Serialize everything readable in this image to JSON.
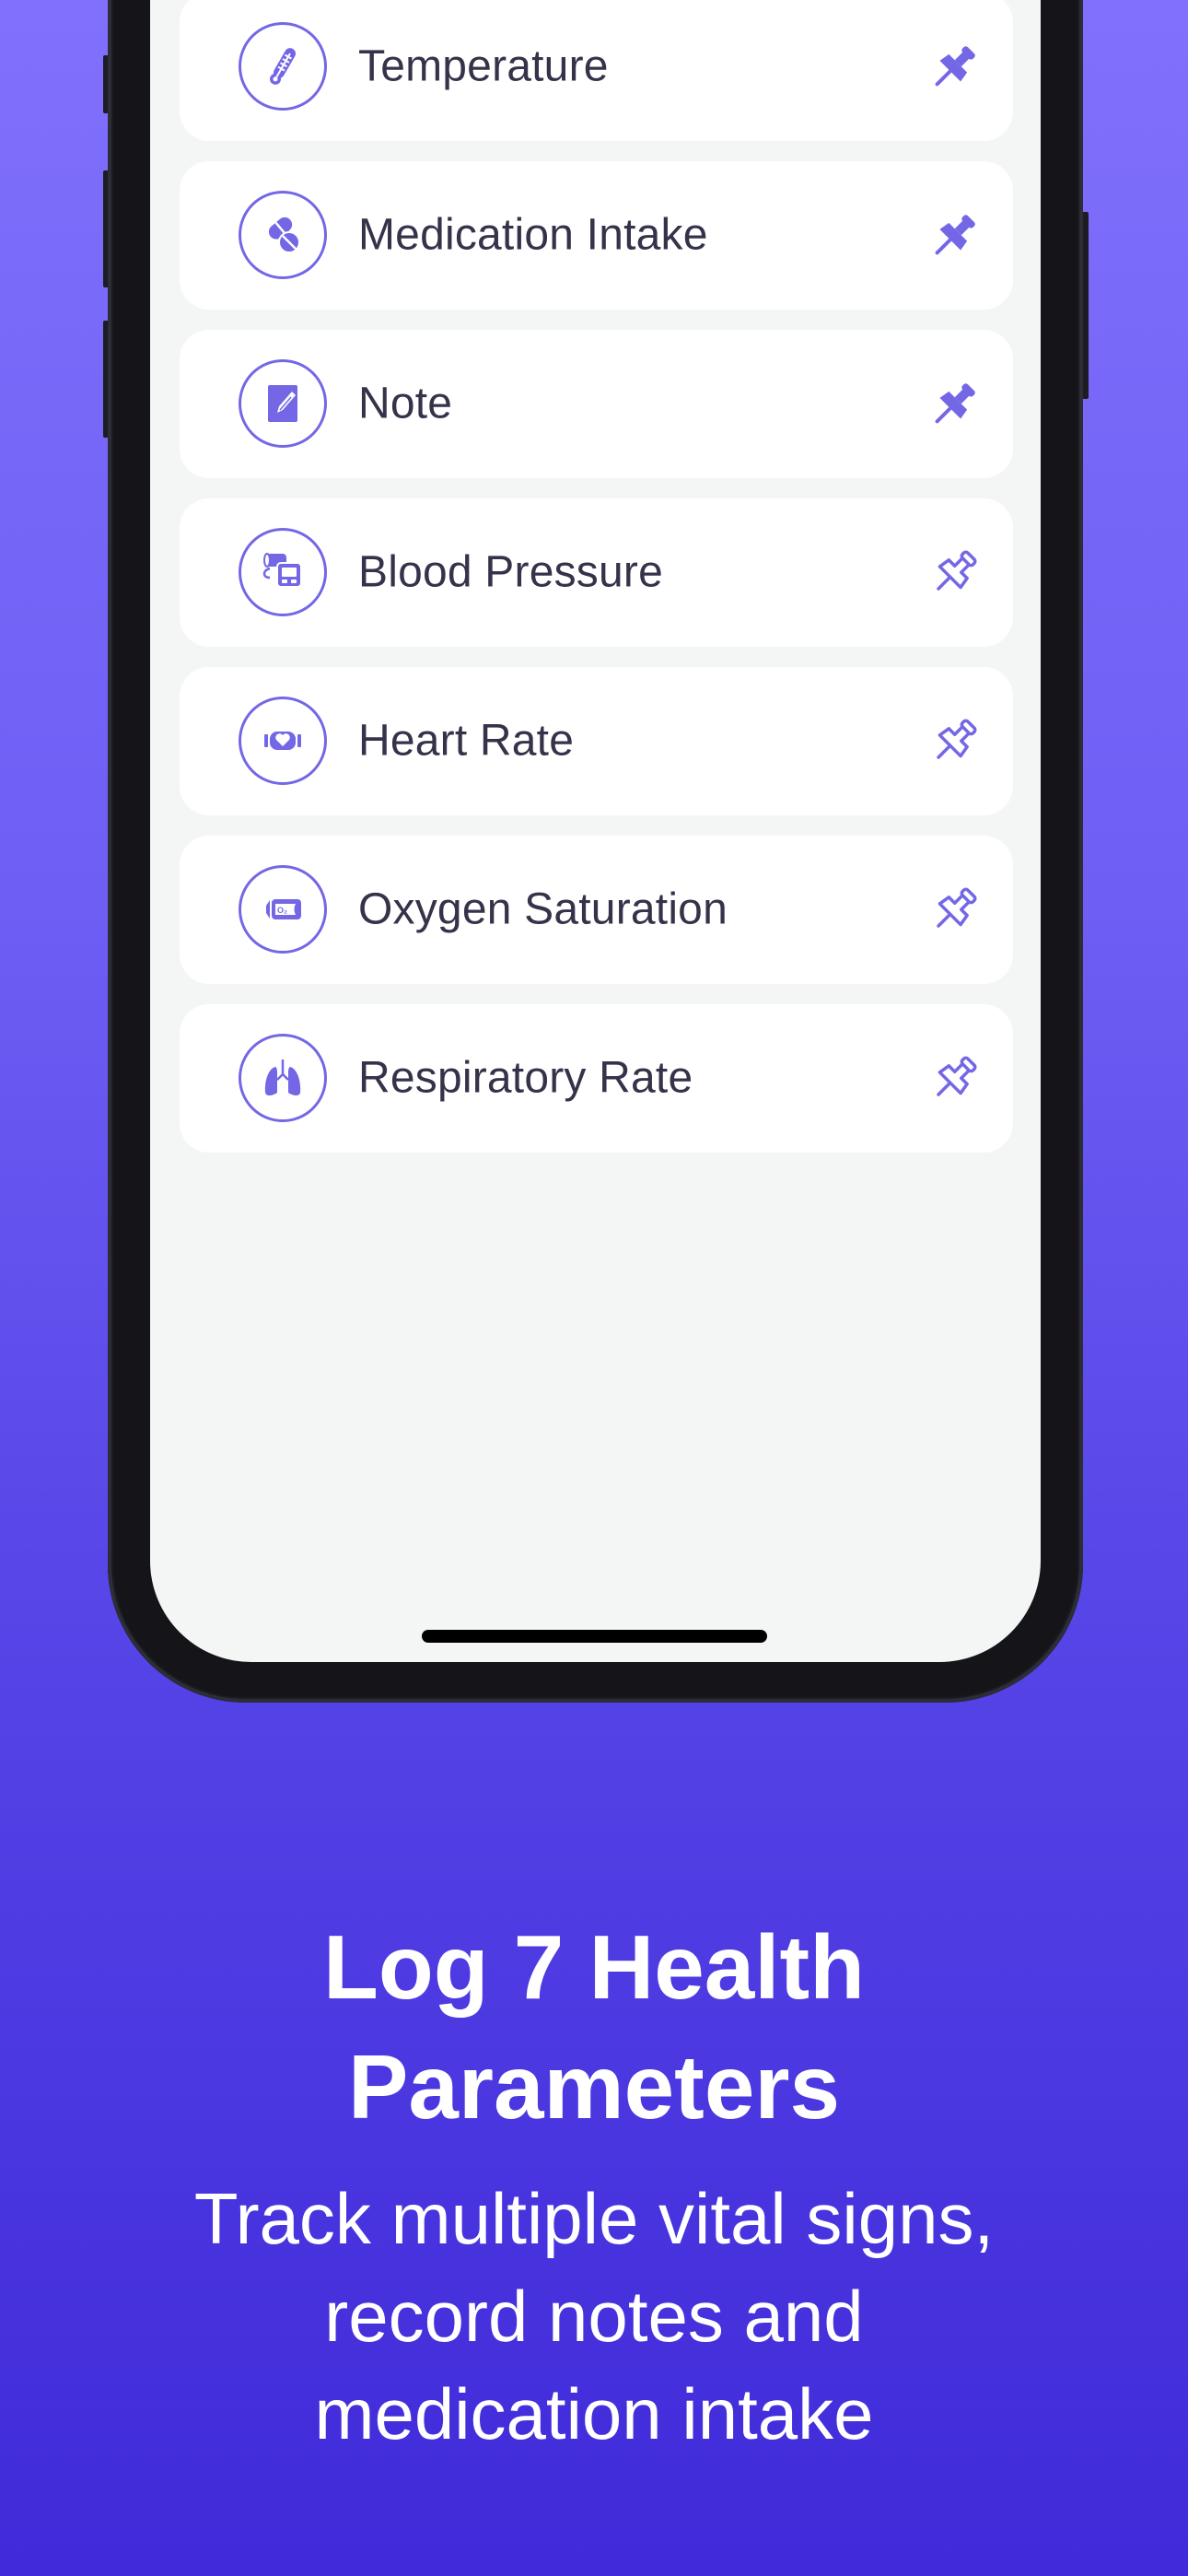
{
  "colors": {
    "accent": "#7367e6",
    "text": "#35334a",
    "background_top": "#8070fc",
    "background_bottom": "#402ad9"
  },
  "parameters": [
    {
      "label": "Temperature",
      "icon": "thermometer-icon",
      "pinned": true
    },
    {
      "label": "Medication Intake",
      "icon": "pills-icon",
      "pinned": true
    },
    {
      "label": "Note",
      "icon": "note-icon",
      "pinned": true
    },
    {
      "label": "Blood Pressure",
      "icon": "blood-pressure-monitor-icon",
      "pinned": false
    },
    {
      "label": "Heart Rate",
      "icon": "heart-rate-band-icon",
      "pinned": false
    },
    {
      "label": "Oxygen Saturation",
      "icon": "pulse-oximeter-icon",
      "pinned": false
    },
    {
      "label": "Respiratory Rate",
      "icon": "lungs-icon",
      "pinned": false
    }
  ],
  "caption": {
    "title_lines": [
      "Log 7 Health",
      "Parameters"
    ],
    "subtitle_lines": [
      "Track multiple vital signs,",
      "record notes and",
      "medication intake"
    ]
  }
}
